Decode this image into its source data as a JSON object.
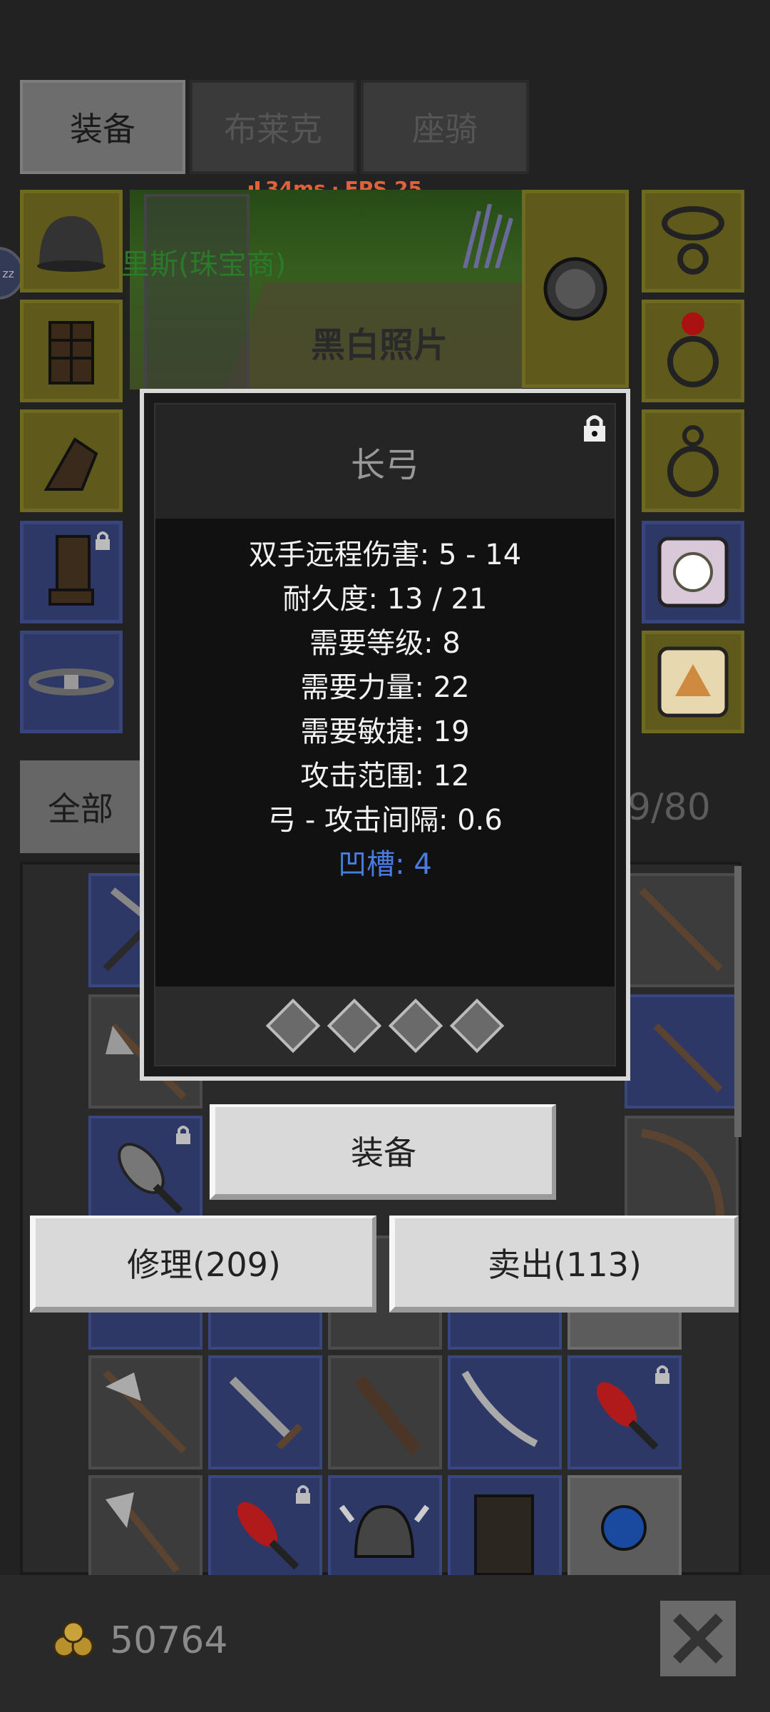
{
  "tabs": [
    {
      "label": "装备",
      "active": true
    },
    {
      "label": "布莱克",
      "active": false
    },
    {
      "label": "座骑",
      "active": false
    }
  ],
  "status": {
    "ping": "34ms",
    "separator": "·",
    "fps": "FPS 25"
  },
  "scene": {
    "npc_name": "里斯(珠宝商)",
    "photo_label": "黑白照片",
    "sleep_badge": "zz"
  },
  "inventory": {
    "filter_label": "全部",
    "count": "9/80"
  },
  "popup": {
    "title": "长弓",
    "stats": [
      "双手远程伤害: 5 - 14",
      "耐久度: 13 / 21",
      "需要等级: 8",
      "需要力量: 22",
      "需要敏捷: 19",
      "攻击范围: 12",
      "弓 - 攻击间隔: 0.6"
    ],
    "sockets_label": "凹槽: 4",
    "socket_count": 4
  },
  "actions": {
    "equip": "装备",
    "repair": "修理(209)",
    "sell": "卖出(113)"
  },
  "gold": {
    "amount": "50764"
  },
  "colors": {
    "accent_blue": "#4a7ce0",
    "status_red": "#e0623d"
  }
}
